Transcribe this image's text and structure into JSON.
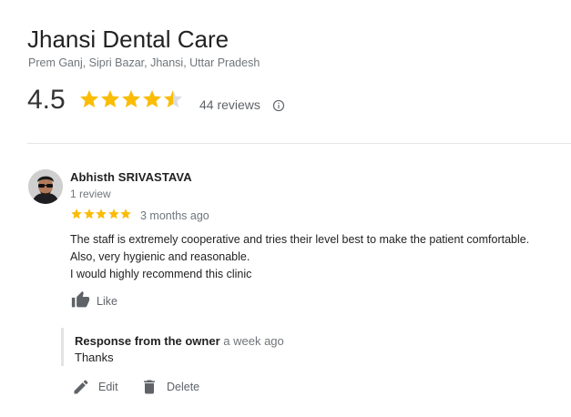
{
  "business": {
    "name": "Jhansi Dental Care",
    "address": "Prem Ganj, Sipri Bazar, Jhansi, Uttar Pradesh",
    "rating": "4.5",
    "rating_stars": 4.5,
    "reviews_label": "44 reviews",
    "info_icon": "info-icon"
  },
  "review": {
    "author": "Abhisth SRIVASTAVA",
    "author_meta": "1 review",
    "stars": 5,
    "date": "3 months ago",
    "text_lines": [
      "The staff is extremely cooperative and tries their level best to make the patient comfortable.",
      "Also, very hygienic and reasonable.",
      "I would highly recommend this clinic"
    ],
    "like_label": "Like"
  },
  "owner_response": {
    "title": "Response from the owner",
    "when": "a week ago",
    "text": "Thanks"
  },
  "actions": {
    "edit_label": "Edit",
    "delete_label": "Delete"
  },
  "colors": {
    "star": "#fbbc04",
    "star_empty": "#dadce0",
    "muted_text": "#70757a",
    "icon": "#5f6368"
  }
}
